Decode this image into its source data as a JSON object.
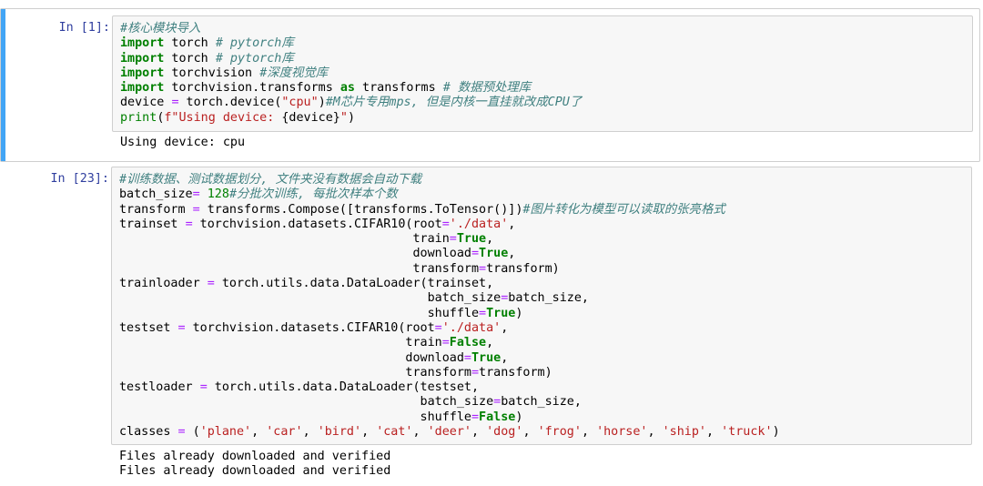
{
  "cell1": {
    "prompt": "In [1]:",
    "code": {
      "l1": "#核心模块导入",
      "l2_kw": "import",
      "l2_mod": " torch ",
      "l2_cm": "# pytorch库",
      "l3_kw": "import",
      "l3_mod": " torch ",
      "l3_cm": "# pytorch库",
      "l4_kw": "import",
      "l4_mod": " torchvision ",
      "l4_cm": "#深度视觉库",
      "l5_kw": "import",
      "l5_mod": " torchvision.transforms ",
      "l5_as": "as",
      "l5_alias": " transforms ",
      "l5_cm": "# 数据预处理库",
      "l6_a": "device ",
      "l6_eq": "=",
      "l6_b": " torch.device(",
      "l6_str": "\"cpu\"",
      "l6_c": ")",
      "l6_cm": "#M芯片专用mps, 但是内核一直挂就改成CPU了",
      "l7_fn": "print",
      "l7_a": "(",
      "l7_str1": "f\"Using device: ",
      "l7_var": "{device}",
      "l7_str2": "\"",
      "l7_b": ")"
    },
    "output": "Using device: cpu"
  },
  "cell2": {
    "prompt": "In [23]:",
    "code": {
      "l1": "#训练数据、测试数据划分, 文件夹没有数据会自动下载",
      "l2_a": "batch_size",
      "l2_eq": "=",
      "l2_num": " 128",
      "l2_cm": "#分批次训练, 每批次样本个数",
      "l3_a": "transform ",
      "l3_eq": "=",
      "l3_b": " transforms.Compose([transforms.ToTensor()])",
      "l3_cm": "#图片转化为模型可以读取的张亮格式",
      "l4_a": "trainset ",
      "l4_eq": "=",
      "l4_b": " torchvision.datasets.CIFAR10(root",
      "l4_eq2": "=",
      "l4_str": "'./data'",
      "l4_c": ",",
      "l5_pad": "                                        ",
      "l5_a": "train",
      "l5_eq": "=",
      "l5_kw": "True",
      "l5_c": ",",
      "l6_pad": "                                        ",
      "l6_a": "download",
      "l6_eq": "=",
      "l6_kw": "True",
      "l6_c": ",",
      "l7_pad": "                                        ",
      "l7_a": "transform",
      "l7_eq": "=",
      "l7_b": "transform)",
      "l8_a": "trainloader ",
      "l8_eq": "=",
      "l8_b": " torch.utils.data.DataLoader(trainset,",
      "l9_pad": "                                          ",
      "l9_a": "batch_size",
      "l9_eq": "=",
      "l9_b": "batch_size,",
      "l10_pad": "                                          ",
      "l10_a": "shuffle",
      "l10_eq": "=",
      "l10_kw": "True",
      "l10_c": ")",
      "l11_a": "testset ",
      "l11_eq": "=",
      "l11_b": " torchvision.datasets.CIFAR10(root",
      "l11_eq2": "=",
      "l11_str": "'./data'",
      "l11_c": ",",
      "l12_pad": "                                       ",
      "l12_a": "train",
      "l12_eq": "=",
      "l12_kw": "False",
      "l12_c": ",",
      "l13_pad": "                                       ",
      "l13_a": "download",
      "l13_eq": "=",
      "l13_kw": "True",
      "l13_c": ",",
      "l14_pad": "                                       ",
      "l14_a": "transform",
      "l14_eq": "=",
      "l14_b": "transform)",
      "l15_a": "testloader ",
      "l15_eq": "=",
      "l15_b": " torch.utils.data.DataLoader(testset,",
      "l16_pad": "                                         ",
      "l16_a": "batch_size",
      "l16_eq": "=",
      "l16_b": "batch_size,",
      "l17_pad": "                                         ",
      "l17_a": "shuffle",
      "l17_eq": "=",
      "l17_kw": "False",
      "l17_c": ")",
      "l18_a": "classes ",
      "l18_eq": "=",
      "l18_b": " (",
      "classes": [
        "'plane'",
        "'car'",
        "'bird'",
        "'cat'",
        "'deer'",
        "'dog'",
        "'frog'",
        "'horse'",
        "'ship'",
        "'truck'"
      ],
      "sep": ", ",
      "l18_c": ")"
    },
    "output": "Files already downloaded and verified\nFiles already downloaded and verified"
  },
  "colors": {
    "selected_bar": "#42a5f5",
    "prompt": "#303f9f",
    "keyword": "#008000",
    "comment": "#408080",
    "string": "#ba2121",
    "operator": "#aa22ff",
    "input_bg": "#f7f7f7"
  }
}
